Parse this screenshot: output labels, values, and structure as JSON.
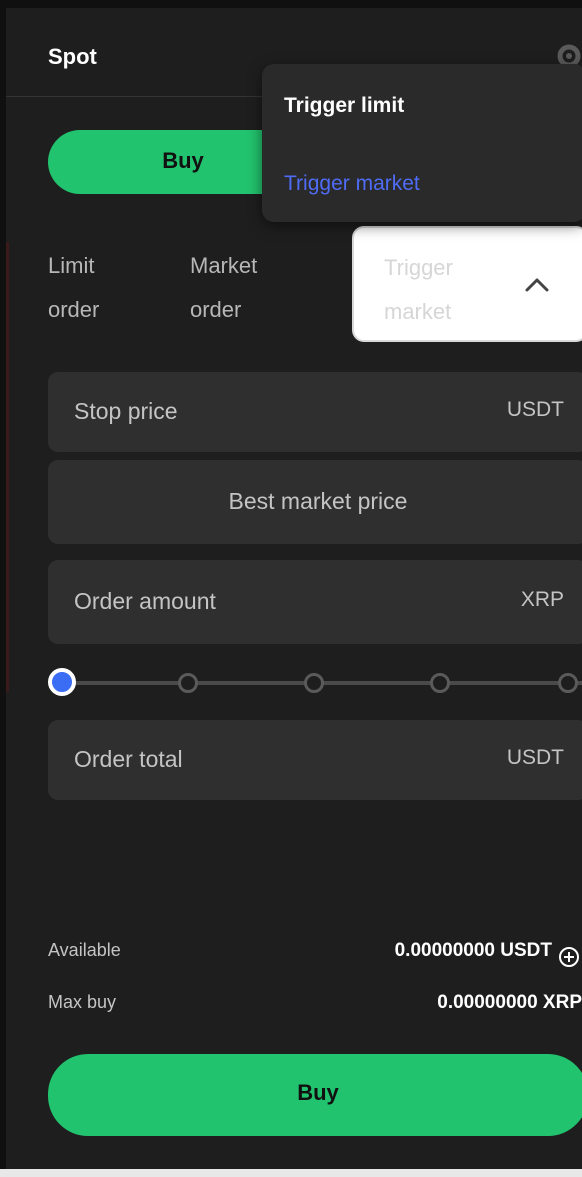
{
  "header": {
    "title": "Spot"
  },
  "side": {
    "buy_label": "Buy"
  },
  "tabs": {
    "limit_line1": "Limit",
    "limit_line2": "order",
    "market_line1": "Market",
    "market_line2": "order",
    "trigger_line1": "Trigger",
    "trigger_line2": "market"
  },
  "dropdown": {
    "items": [
      "Trigger limit",
      "Trigger market"
    ]
  },
  "fields": {
    "stop_price": {
      "placeholder": "Stop price",
      "unit": "USDT"
    },
    "price_mode": {
      "text": "Best market price"
    },
    "order_amount": {
      "placeholder": "Order amount",
      "unit": "XRP"
    },
    "order_total": {
      "placeholder": "Order total",
      "unit": "USDT"
    }
  },
  "slider": {
    "value": 0,
    "stops": 5
  },
  "balance": {
    "available_label": "Available",
    "available_value": "0.00000000 USDT",
    "maxbuy_label": "Max buy",
    "maxbuy_value": "0.00000000 XRP"
  },
  "submit": {
    "label": "Buy"
  },
  "colors": {
    "buy": "#22c36e",
    "accent_blue": "#4f6cf6",
    "panel": "#1e1e1e"
  }
}
